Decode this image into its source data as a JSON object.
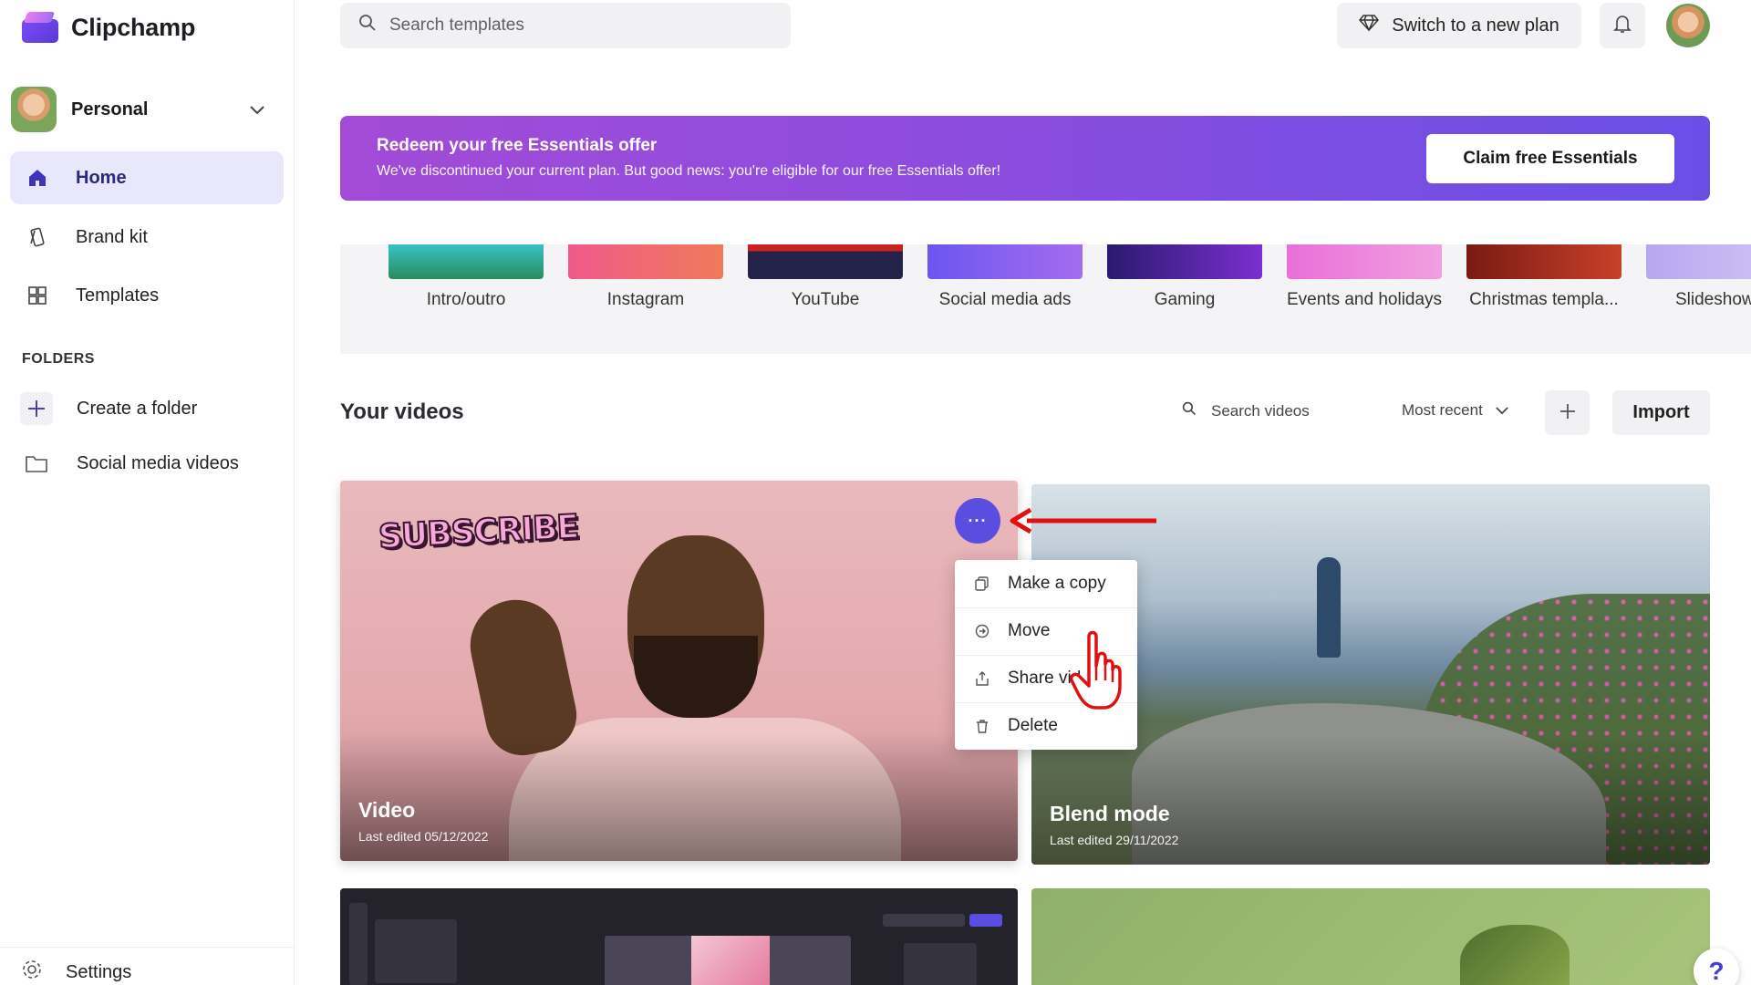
{
  "app": {
    "name": "Clipchamp"
  },
  "account": {
    "name": "Personal"
  },
  "sidebar": {
    "nav": [
      {
        "label": "Home",
        "icon": "home-icon",
        "active": true
      },
      {
        "label": "Brand kit",
        "icon": "brand-kit-icon",
        "active": false
      },
      {
        "label": "Templates",
        "icon": "templates-icon",
        "active": false
      }
    ],
    "folders_label": "FOLDERS",
    "folders": [
      {
        "label": "Create a folder",
        "icon": "plus-icon"
      },
      {
        "label": "Social media videos",
        "icon": "folder-icon"
      }
    ],
    "settings_label": "Settings"
  },
  "topbar": {
    "search_placeholder": "Search templates",
    "plan_button": "Switch to a new plan"
  },
  "banner": {
    "title": "Redeem your free Essentials offer",
    "subtitle": "We've discontinued your current plan. But good news: you're eligible for our free Essentials offer!",
    "button": "Claim free Essentials"
  },
  "template_categories": [
    "Intro/outro",
    "Instagram",
    "YouTube",
    "Social media ads",
    "Gaming",
    "Events and holidays",
    "Christmas templa...",
    "Slideshow"
  ],
  "your_videos": {
    "title": "Your videos",
    "search_placeholder": "Search videos",
    "sort": "Most recent",
    "import_label": "Import",
    "videos": [
      {
        "title": "Video",
        "last_edited": "Last edited 05/12/2022",
        "overlay_text": "SUBSCRIBE"
      },
      {
        "title": "Blend mode",
        "last_edited": "Last edited 29/11/2022"
      }
    ]
  },
  "context_menu": {
    "items": [
      {
        "label": "Make a copy",
        "icon": "copy-icon"
      },
      {
        "label": "Move",
        "icon": "move-icon"
      },
      {
        "label": "Share vid",
        "icon": "share-icon"
      },
      {
        "label": "Delete",
        "icon": "trash-icon"
      }
    ]
  },
  "more_button": "···",
  "help_button": "?",
  "colors": {
    "accent": "#5b4de0",
    "active_nav_bg": "#e9e7fb",
    "banner_start": "#a24bd7",
    "banner_end": "#6a4fe6",
    "annotation_red": "#e01010"
  }
}
